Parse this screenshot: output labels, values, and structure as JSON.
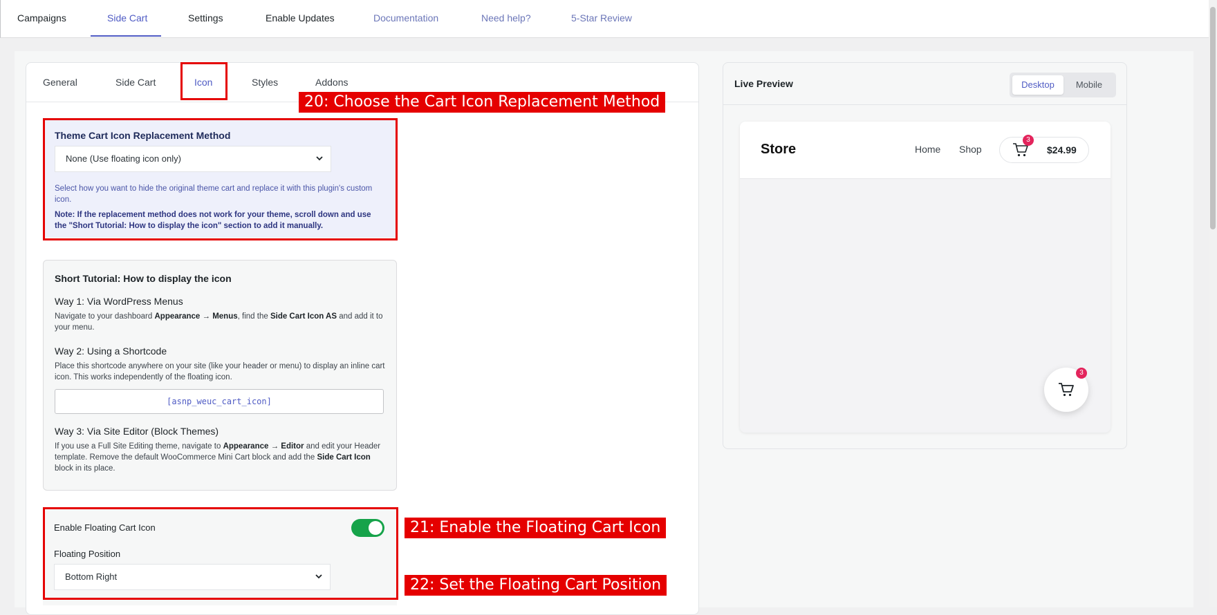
{
  "topnav": {
    "tabs": [
      {
        "label": "Campaigns"
      },
      {
        "label": "Side Cart"
      },
      {
        "label": "Settings"
      },
      {
        "label": "Enable Updates"
      },
      {
        "label": "Documentation"
      },
      {
        "label": "Need help?"
      },
      {
        "label": "5-Star Review"
      }
    ],
    "active_index": 1
  },
  "subtabs": [
    "General",
    "Side Cart",
    "Icon",
    "Styles",
    "Addons"
  ],
  "callouts": {
    "c20": "20: Choose the Cart Icon Replacement Method",
    "c21": "21: Enable the Floating Cart Icon",
    "c22": "22: Set the Floating Cart Position"
  },
  "method": {
    "title": "Theme Cart Icon Replacement Method",
    "selected": "None (Use floating icon only)",
    "description": "Select how you want to hide the original theme cart and replace it with this plugin's custom icon.",
    "note": "Note: If the replacement method does not work for your theme, scroll down and use the \"Short Tutorial: How to display the icon\" section to add it manually."
  },
  "tutorial": {
    "title": "Short Tutorial: How to display the icon",
    "way1_title": "Way 1: Via WordPress Menus",
    "way1_a": "Navigate to your dashboard ",
    "way1_b": "Appearance → Menus",
    "way1_c": ", find the ",
    "way1_d": "Side Cart Icon AS",
    "way1_e": " and add it to your menu.",
    "way2_title": "Way 2: Using a Shortcode",
    "way2_text": "Place this shortcode anywhere on your site (like your header or menu) to display an inline cart icon. This works independently of the floating icon.",
    "shortcode": "[asnp_weuc_cart_icon]",
    "way3_title": "Way 3: Via Site Editor (Block Themes)",
    "way3_a": "If you use a Full Site Editing theme, navigate to ",
    "way3_b": "Appearance → Editor",
    "way3_c": " and edit your Header template. Remove the default WooCommerce Mini Cart block and add the ",
    "way3_d": "Side Cart Icon",
    "way3_e": " block in its place."
  },
  "floating": {
    "enable_label": "Enable Floating Cart Icon",
    "enabled": true,
    "position_label": "Floating Position",
    "position_value": "Bottom Right"
  },
  "preview": {
    "title": "Live Preview",
    "devices": [
      "Desktop",
      "Mobile"
    ],
    "active_device": "Desktop",
    "store_name": "Store",
    "nav": [
      "Home",
      "Shop"
    ],
    "cart_count": "3",
    "cart_total": "$24.99",
    "fab_count": "3"
  },
  "colors": {
    "accent": "#4f5bc4",
    "annotation_red": "#e50000",
    "toggle_on": "#16a34a",
    "badge": "#e3245c"
  }
}
